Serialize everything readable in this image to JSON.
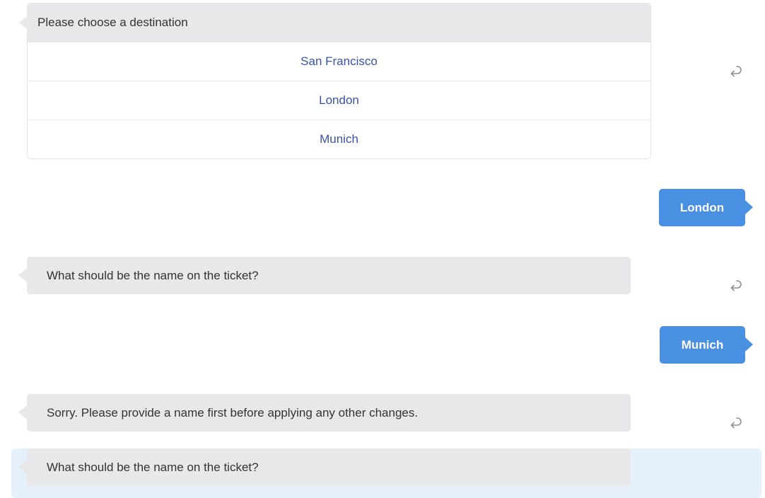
{
  "prompt_card": {
    "title": "Please choose a destination",
    "options": [
      "San Francisco",
      "London",
      "Munich"
    ]
  },
  "messages": {
    "user_reply_1": "London",
    "bot_question_1": "What should be the name on the ticket?",
    "user_reply_2": "Munich",
    "bot_error": "Sorry. Please provide a name first before applying any other changes.",
    "bot_question_2": "What should be the name on the ticket?"
  },
  "colors": {
    "bot_bubble": "#e8e8eb",
    "user_bubble": "#4a90e2",
    "option_text": "#3a53a4",
    "highlight": "#e6f0fa"
  },
  "icons": {
    "reply": "reply-arrow-icon"
  }
}
